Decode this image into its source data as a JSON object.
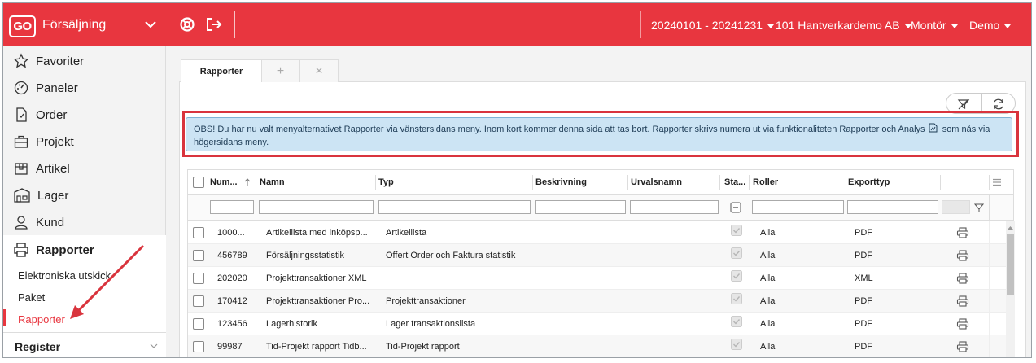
{
  "header": {
    "logo": "GO",
    "app_name": "Försäljning",
    "period": "20240101 - 20241231",
    "company": "101 Hantverkardemo AB",
    "role": "Montör",
    "user": "Demo"
  },
  "sidebar": {
    "items": [
      {
        "label": "Favoriter",
        "icon": "star-icon"
      },
      {
        "label": "Paneler",
        "icon": "dashboard-icon"
      },
      {
        "label": "Order",
        "icon": "document-icon"
      },
      {
        "label": "Projekt",
        "icon": "briefcase-icon"
      },
      {
        "label": "Artikel",
        "icon": "box-icon"
      },
      {
        "label": "Lager",
        "icon": "warehouse-icon"
      },
      {
        "label": "Kund",
        "icon": "person-icon"
      },
      {
        "label": "Rapporter",
        "icon": "printer-icon"
      }
    ],
    "subitems": [
      "Elektroniska utskick",
      "Paket",
      "Rapporter"
    ],
    "register_label": "Register"
  },
  "tabs": {
    "active": "Rapporter",
    "add": "+",
    "close": "×"
  },
  "banner": {
    "text_before": "OBS! Du har nu valt menyalternativet Rapporter via vänstersidans meny. Inom kort kommer denna sida att tas bort. Rapporter skrivs numera ut via funktionaliteten Rapporter och Analys",
    "text_after": "som nås via högersidans meny."
  },
  "table": {
    "columns": [
      "Num...",
      "Namn",
      "Typ",
      "Beskrivning",
      "Urvalsnamn",
      "Sta...",
      "Roller",
      "Exporttyp"
    ],
    "rows": [
      {
        "number": "1000...",
        "name": "Artikellista med inköpsp...",
        "type": "Artikellista",
        "desc": "",
        "selection": "",
        "roles": "Alla",
        "export": "PDF"
      },
      {
        "number": "456789",
        "name": "Försäljningsstatistik",
        "type": "Offert Order och Faktura statistik",
        "desc": "",
        "selection": "",
        "roles": "Alla",
        "export": "PDF"
      },
      {
        "number": "202020",
        "name": "Projekttransaktioner XML",
        "type": "",
        "desc": "",
        "selection": "",
        "roles": "Alla",
        "export": "XML"
      },
      {
        "number": "170412",
        "name": "Projekttransaktioner Pro...",
        "type": "Projekttransaktioner",
        "desc": "",
        "selection": "",
        "roles": "Alla",
        "export": "PDF"
      },
      {
        "number": "123456",
        "name": "Lagerhistorik",
        "type": "Lager transaktionslista",
        "desc": "",
        "selection": "",
        "roles": "Alla",
        "export": "PDF"
      },
      {
        "number": "99987",
        "name": "Tid-Projekt rapport Tidb...",
        "type": "Tid-Projekt rapport",
        "desc": "",
        "selection": "",
        "roles": "Alla",
        "export": "PDF"
      }
    ]
  },
  "colors": {
    "brand": "#e8363f",
    "banner_bg": "#cce4f4",
    "highlight": "#d9343d",
    "arrow": "#d9343d"
  }
}
